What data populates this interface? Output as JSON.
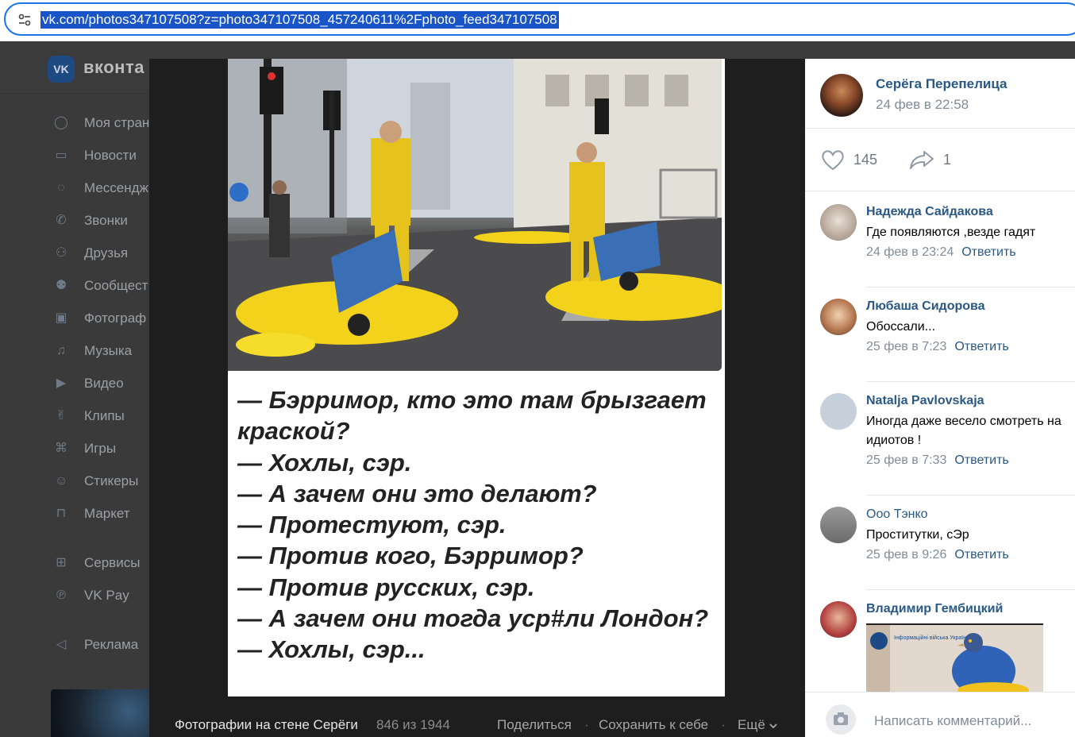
{
  "browser": {
    "url": "vk.com/photos347107508?z=photo347107508_457240611%2Fphoto_feed347107508"
  },
  "vk": {
    "logo_text": "VK",
    "brand": "вконта",
    "menu": [
      {
        "label": "Моя стран",
        "icon": "user-circle-icon"
      },
      {
        "label": "Новости",
        "icon": "newspaper-icon"
      },
      {
        "label": "Мессендж",
        "icon": "message-icon"
      },
      {
        "label": "Звонки",
        "icon": "phone-icon"
      },
      {
        "label": "Друзья",
        "icon": "friends-icon"
      },
      {
        "label": "Сообщест",
        "icon": "communities-icon"
      },
      {
        "label": "Фотограф",
        "icon": "photo-icon"
      },
      {
        "label": "Музыка",
        "icon": "music-icon"
      },
      {
        "label": "Видео",
        "icon": "video-icon"
      },
      {
        "label": "Клипы",
        "icon": "clips-icon"
      },
      {
        "label": "Игры",
        "icon": "gamepad-icon"
      },
      {
        "label": "Стикеры",
        "icon": "sticker-icon"
      },
      {
        "label": "Маркет",
        "icon": "market-bag-icon"
      }
    ],
    "menu2": [
      {
        "label": "Сервисы",
        "icon": "services-grid-icon"
      },
      {
        "label": "VK Pay",
        "icon": "vkpay-icon"
      }
    ],
    "menu3": [
      {
        "label": "Реклама",
        "icon": "megaphone-icon"
      }
    ]
  },
  "viewer": {
    "caption_lines": [
      "— Бэрримор, кто это там брызгает",
      "краской?",
      "— Хохлы, сэр.",
      "— А зачем они это делают?",
      "— Протестуют, сэр.",
      "— Против кого, Бэрримор?",
      "— Против русских, сэр.",
      "— А зачем они тогда уср#ли Лондон?",
      "— Хохлы, сэр..."
    ],
    "album": "Фотографии на стене Серёги",
    "counter": "846 из 1944",
    "share": "Поделиться",
    "save": "Сохранить к себе",
    "more": "Ещё",
    "separator": "·"
  },
  "panel": {
    "author": "Серёга Перепелица",
    "date": "24 фев в 22:58",
    "likes": "145",
    "shares": "1",
    "reply_label": "Ответить",
    "comments": [
      {
        "name": "Надежда Сайдакова",
        "text": "Где появляются ,везде гадят",
        "date": "24 фев в 23:24"
      },
      {
        "name": "Любаша Сидорова",
        "text": "Обоссали...",
        "date": "25 фев в 7:23"
      },
      {
        "name": "Natalja Pavlovskaja",
        "text": "Иногда даже весело смотреть на идиотов !",
        "date": "25 фев в 7:33"
      },
      {
        "name": "Ооо Тэнко",
        "text": "Проститутки, сЭр",
        "date": "25 фев в 9:26"
      },
      {
        "name": "Владимир Гембицкий",
        "text": "",
        "date": ""
      }
    ],
    "attachment_caption": "Інформаційні війська України",
    "compose_placeholder": "Написать комментарий..."
  }
}
